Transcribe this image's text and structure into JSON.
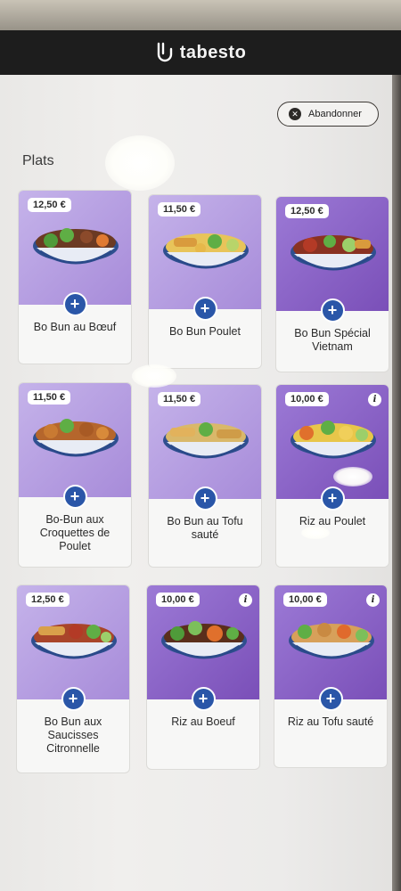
{
  "header": {
    "brand": "tabesto"
  },
  "toolbar": {
    "abandon_label": "Abandonner"
  },
  "section": {
    "title": "Plats"
  },
  "products": [
    {
      "name": "Bo Bun au Bœuf",
      "price": "12,50 €",
      "info": false,
      "add": "+"
    },
    {
      "name": "Bo Bun Poulet",
      "price": "11,50 €",
      "info": false,
      "add": "+"
    },
    {
      "name": "Bo Bun Spécial Vietnam",
      "price": "12,50 €",
      "info": false,
      "add": "+"
    },
    {
      "name": "Bo-Bun aux Croquettes de Poulet",
      "price": "11,50 €",
      "info": false,
      "add": "+"
    },
    {
      "name": "Bo Bun au Tofu sauté",
      "price": "11,50 €",
      "info": false,
      "add": "+"
    },
    {
      "name": "Riz au Poulet",
      "price": "10,00 €",
      "info": true,
      "add": "+"
    },
    {
      "name": "Bo Bun aux Saucisses Citronnelle",
      "price": "12,50 €",
      "info": false,
      "add": "+"
    },
    {
      "name": "Riz au Boeuf",
      "price": "10,00 €",
      "info": true,
      "add": "+"
    },
    {
      "name": "Riz au Tofu sauté",
      "price": "10,00 €",
      "info": true,
      "add": "+"
    }
  ],
  "icons": {
    "abandon": "close-circle-icon",
    "add": "plus-icon",
    "info": "info-icon"
  },
  "colors": {
    "accent": "#2a56a8",
    "image_bg": "#8a5fc7",
    "kiosk_bar": "#1d1d1d"
  }
}
